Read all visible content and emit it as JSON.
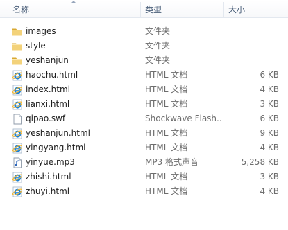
{
  "columns": {
    "name": "名称",
    "type": "类型",
    "size": "大小"
  },
  "rows": [
    {
      "name": "images",
      "type": "文件夹",
      "size": "",
      "icon": "folder-icon"
    },
    {
      "name": "style",
      "type": "文件夹",
      "size": "",
      "icon": "folder-icon"
    },
    {
      "name": "yeshanjun",
      "type": "文件夹",
      "size": "",
      "icon": "folder-icon"
    },
    {
      "name": "haochu.html",
      "type": "HTML 文档",
      "size": "6 KB",
      "icon": "ie-html-icon"
    },
    {
      "name": "index.html",
      "type": "HTML 文档",
      "size": "4 KB",
      "icon": "ie-html-icon"
    },
    {
      "name": "lianxi.html",
      "type": "HTML 文档",
      "size": "3 KB",
      "icon": "ie-html-icon"
    },
    {
      "name": "qipao.swf",
      "type": "Shockwave Flash...",
      "size": "6 KB",
      "icon": "blank-file-icon"
    },
    {
      "name": "yeshanjun.html",
      "type": "HTML 文档",
      "size": "9 KB",
      "icon": "ie-html-icon"
    },
    {
      "name": "yingyang.html",
      "type": "HTML 文档",
      "size": "4 KB",
      "icon": "ie-html-icon"
    },
    {
      "name": "yinyue.mp3",
      "type": "MP3 格式声音",
      "size": "5,258 KB",
      "icon": "audio-file-icon"
    },
    {
      "name": "zhishi.html",
      "type": "HTML 文档",
      "size": "3 KB",
      "icon": "ie-html-icon"
    },
    {
      "name": "zhuyi.html",
      "type": "HTML 文档",
      "size": "4 KB",
      "icon": "ie-html-icon"
    }
  ],
  "colors": {
    "header_text": "#4c607a",
    "folder": "#e8c35a",
    "ie_blue": "#1a7fd4",
    "ie_ring": "#f2b632"
  }
}
